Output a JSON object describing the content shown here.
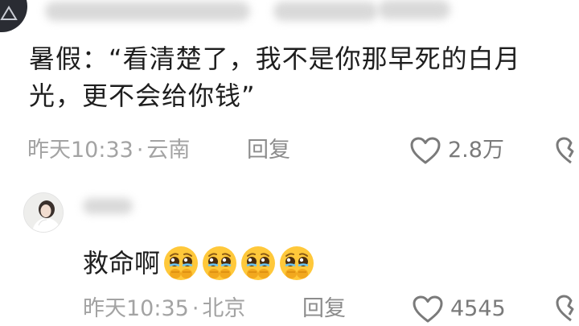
{
  "comment_1": {
    "text": "暑假：“看清楚了，我不是你那早死的白月光，更不会给你钱”",
    "time": "昨天10:33",
    "separator": "·",
    "location": "云南",
    "reply_label": "回复",
    "like_count": "2.8万"
  },
  "comment_2": {
    "text": "救命啊",
    "emoji": [
      "pleading-crying-face",
      "pleading-crying-face",
      "pleading-crying-face",
      "pleading-crying-face"
    ],
    "time": "昨天10:35",
    "separator": "·",
    "location": "北京",
    "reply_label": "回复",
    "like_count": "4545"
  },
  "colors": {
    "text_primary": "#1e1e1e",
    "text_meta": "#a3a3a3",
    "icon": "#7a7a7a",
    "emoji_face": "#ffc83a"
  },
  "icons": {
    "like": "heart-outline-icon",
    "dislike": "broken-heart-icon"
  }
}
